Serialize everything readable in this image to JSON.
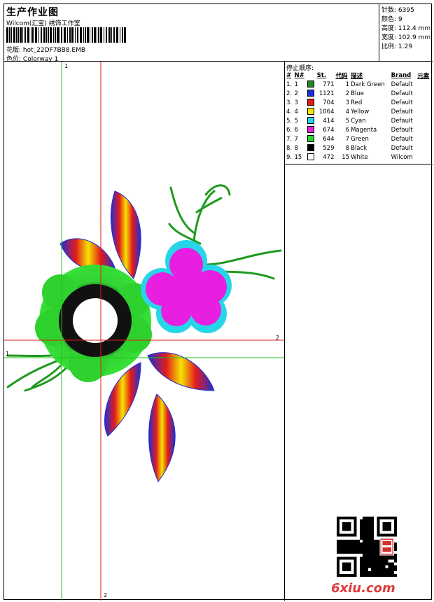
{
  "header": {
    "title": "生产作业图",
    "company": "Wilcom(汇宝) 绣饰工作室",
    "design_label": "花版:",
    "design_value": "hot_22DF7BB8.EMB",
    "colorway_label": "色位:",
    "colorway_value": "Colorway 1"
  },
  "stats": [
    {
      "label": "针数:",
      "value": "6395"
    },
    {
      "label": "颜色:",
      "value": "9"
    },
    {
      "label": "高度:",
      "value": "112.4 mm"
    },
    {
      "label": "宽度:",
      "value": "102.9 mm"
    },
    {
      "label": "比例:",
      "value": "1.29"
    }
  ],
  "stop_sequence": {
    "title": "停止顺序:",
    "columns": [
      "#",
      "N#",
      "St.",
      "代码",
      "描述",
      "Brand",
      "元素"
    ],
    "rows": [
      {
        "index": "1.",
        "n": "1",
        "color": "#1f8a1f",
        "st": "771",
        "code": "1",
        "desc": "Dark Green",
        "brand": "Default"
      },
      {
        "index": "2.",
        "n": "2",
        "color": "#1b2fd6",
        "st": "1121",
        "code": "2",
        "desc": "Blue",
        "brand": "Default"
      },
      {
        "index": "3.",
        "n": "3",
        "color": "#e41b1b",
        "st": "704",
        "code": "3",
        "desc": "Red",
        "brand": "Default"
      },
      {
        "index": "4.",
        "n": "4",
        "color": "#f4e400",
        "st": "1064",
        "code": "4",
        "desc": "Yellow",
        "brand": "Default"
      },
      {
        "index": "5.",
        "n": "5",
        "color": "#26d6e8",
        "st": "414",
        "code": "5",
        "desc": "Cyan",
        "brand": "Default"
      },
      {
        "index": "6.",
        "n": "6",
        "color": "#e81ee0",
        "st": "674",
        "code": "6",
        "desc": "Magenta",
        "brand": "Default"
      },
      {
        "index": "7.",
        "n": "7",
        "color": "#2ed12e",
        "st": "644",
        "code": "7",
        "desc": "Green",
        "brand": "Default"
      },
      {
        "index": "8.",
        "n": "8",
        "color": "#000000",
        "st": "529",
        "code": "8",
        "desc": "Black",
        "brand": "Default"
      },
      {
        "index": "9.",
        "n": "15",
        "color": "#ffffff",
        "st": "472",
        "code": "15",
        "desc": "White",
        "brand": "Wilcom"
      }
    ]
  },
  "guides": {
    "v1": "1",
    "h2": "2",
    "h1": "1",
    "v2": "2"
  },
  "watermark": {
    "text": "6xiu",
    "suffix": ".com"
  }
}
